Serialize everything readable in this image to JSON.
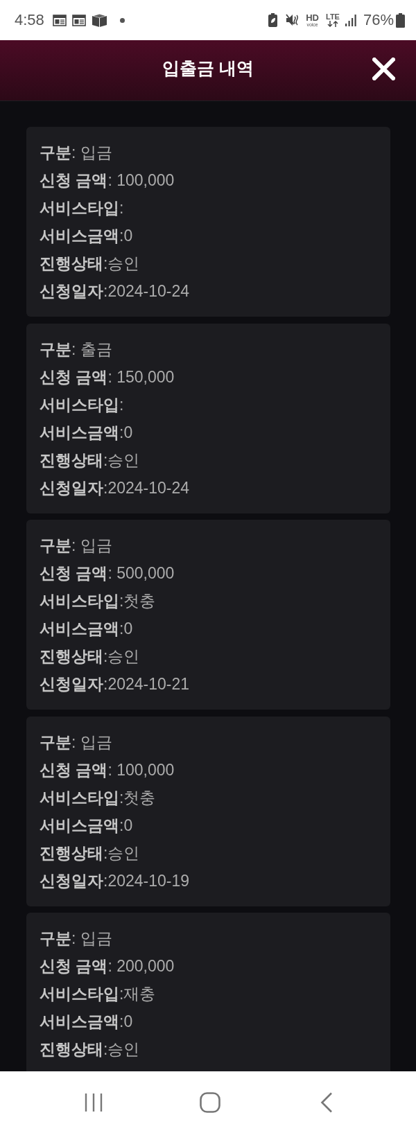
{
  "status_bar": {
    "time": "4:58",
    "hd_label": "HD",
    "voice_label": "voice",
    "network_label": "LTE",
    "battery_percent": "76%"
  },
  "header": {
    "title": "입출금 내역"
  },
  "records": [
    {
      "lines": [
        "**구분**: 입금",
        "**신청 금액**: 100,000",
        "**서비스타입**:",
        "**서비스금액**:0",
        "**진행상태**:승인",
        "**신청일자**:2024-10-24"
      ]
    },
    {
      "lines": [
        "**구분**: 출금",
        "**신청 금액**: 150,000",
        "**서비스타입**:",
        "**서비스금액**:0",
        "**진행상태**:승인",
        "**신청일자**:2024-10-24"
      ]
    },
    {
      "lines": [
        "**구분**: 입금",
        "**신청 금액**: 500,000",
        "**서비스타입**:첫충",
        "**서비스금액**:0",
        "**진행상태**:승인",
        "**신청일자**:2024-10-21"
      ]
    },
    {
      "lines": [
        "**구분**: 입금",
        "**신청 금액**: 100,000",
        "**서비스타입**:첫충",
        "**서비스금액**:0",
        "**진행상태**:승인",
        "**신청일자**:2024-10-19"
      ]
    },
    {
      "lines": [
        "**구분**: 입금",
        "**신청 금액**: 200,000",
        "**서비스타입**:재충",
        "**서비스금액**:0",
        "**진행상태**:승인"
      ]
    }
  ]
}
